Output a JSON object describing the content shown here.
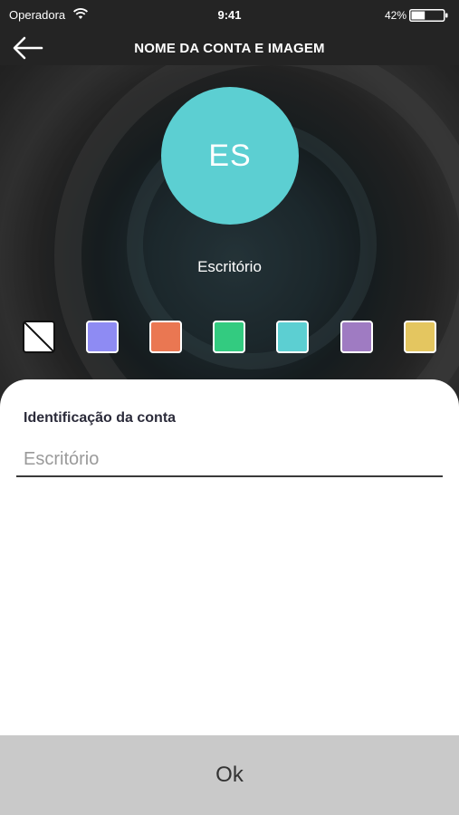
{
  "status_bar": {
    "carrier": "Operadora",
    "time": "9:41",
    "battery_percent": "42%",
    "battery_level": 0.42,
    "wifi_icon": "wifi-icon",
    "battery_icon": "battery-icon"
  },
  "header": {
    "title": "NOME DA CONTA E IMAGEM",
    "back_icon": "arrow-left-icon"
  },
  "avatar": {
    "initials": "ES",
    "color": "#5ccfd2"
  },
  "account": {
    "name": "Escritório"
  },
  "swatches": [
    {
      "name": "none",
      "color": "#ffffff"
    },
    {
      "name": "blue",
      "color": "#8e8bf3"
    },
    {
      "name": "orange",
      "color": "#ea7752"
    },
    {
      "name": "green",
      "color": "#33cb80"
    },
    {
      "name": "cyan",
      "color": "#5ccfd2"
    },
    {
      "name": "purple",
      "color": "#9f7bc2"
    },
    {
      "name": "yellow",
      "color": "#e4c660"
    }
  ],
  "form": {
    "label": "Identificação da conta",
    "placeholder": "Escritório",
    "value": ""
  },
  "actions": {
    "ok_label": "Ok"
  }
}
